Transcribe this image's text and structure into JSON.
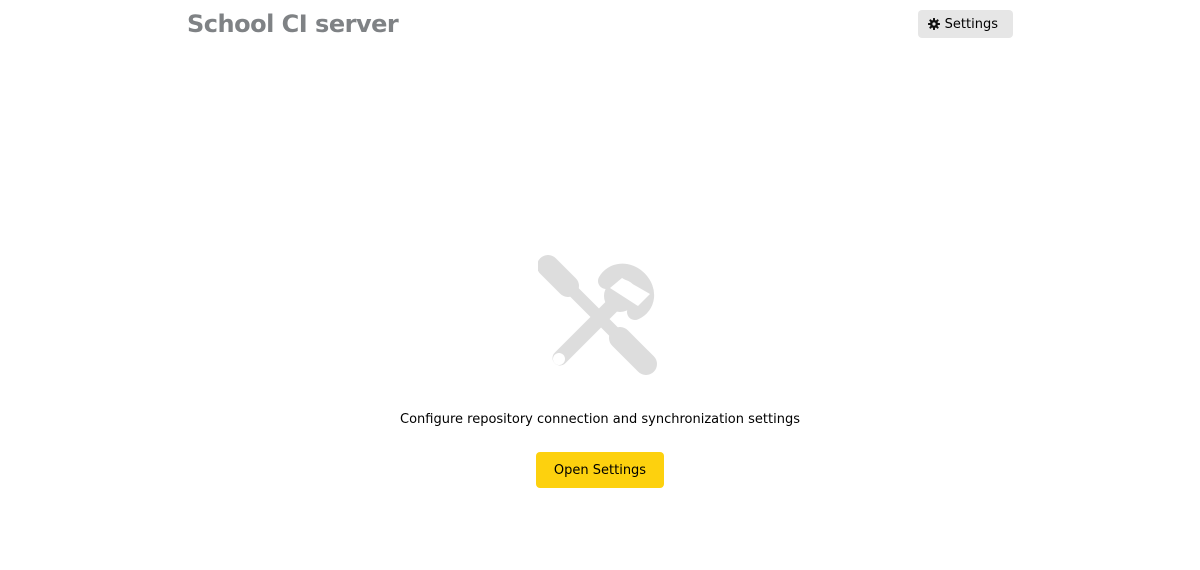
{
  "header": {
    "title": "School CI server",
    "settings_button": {
      "label": "Settings",
      "icon": "gear-icon"
    }
  },
  "main": {
    "icon": "tools-icon",
    "description": "Configure repository connection and synchronization settings",
    "open_settings_label": "Open Settings"
  },
  "colors": {
    "title": "#7f8285",
    "settings_button_bg": "#e6e6e6",
    "primary_button_bg": "#fdd10e",
    "hero_icon": "#dddddd"
  }
}
